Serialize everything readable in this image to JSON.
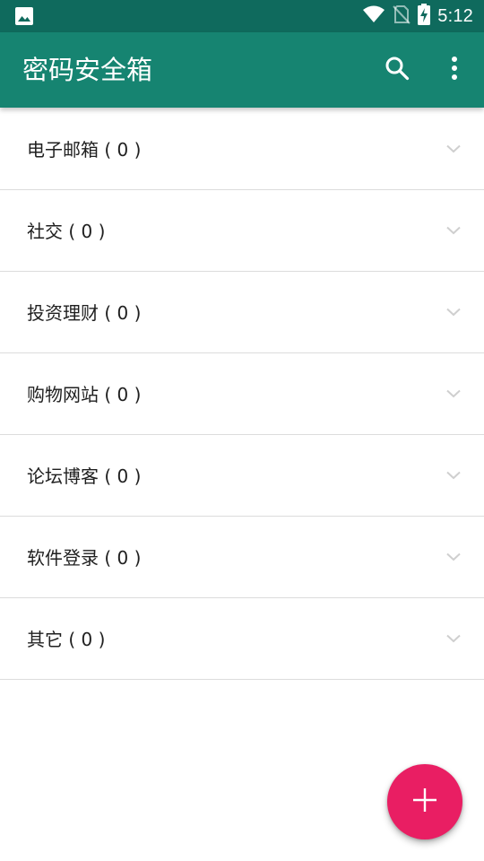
{
  "status_bar": {
    "time": "5:12",
    "icons": [
      "image-icon",
      "wifi-icon",
      "no-sim-icon",
      "battery-charging-icon"
    ]
  },
  "app_bar": {
    "title": "密码安全箱",
    "actions": [
      "search-icon",
      "more-vert-icon"
    ]
  },
  "categories": [
    {
      "label": "电子邮箱 ( 0 )"
    },
    {
      "label": "社交 ( 0 )"
    },
    {
      "label": "投资理财 ( 0 )"
    },
    {
      "label": "购物网站 ( 0 )"
    },
    {
      "label": "论坛博客 ( 0 )"
    },
    {
      "label": "软件登录 ( 0 )"
    },
    {
      "label": "其它 ( 0 )"
    }
  ],
  "fab": {
    "icon": "add-icon"
  },
  "colors": {
    "status_bar": "#0f6a5d",
    "app_bar": "#168471",
    "fab": "#e91e63",
    "divider": "#dcdcdc"
  }
}
